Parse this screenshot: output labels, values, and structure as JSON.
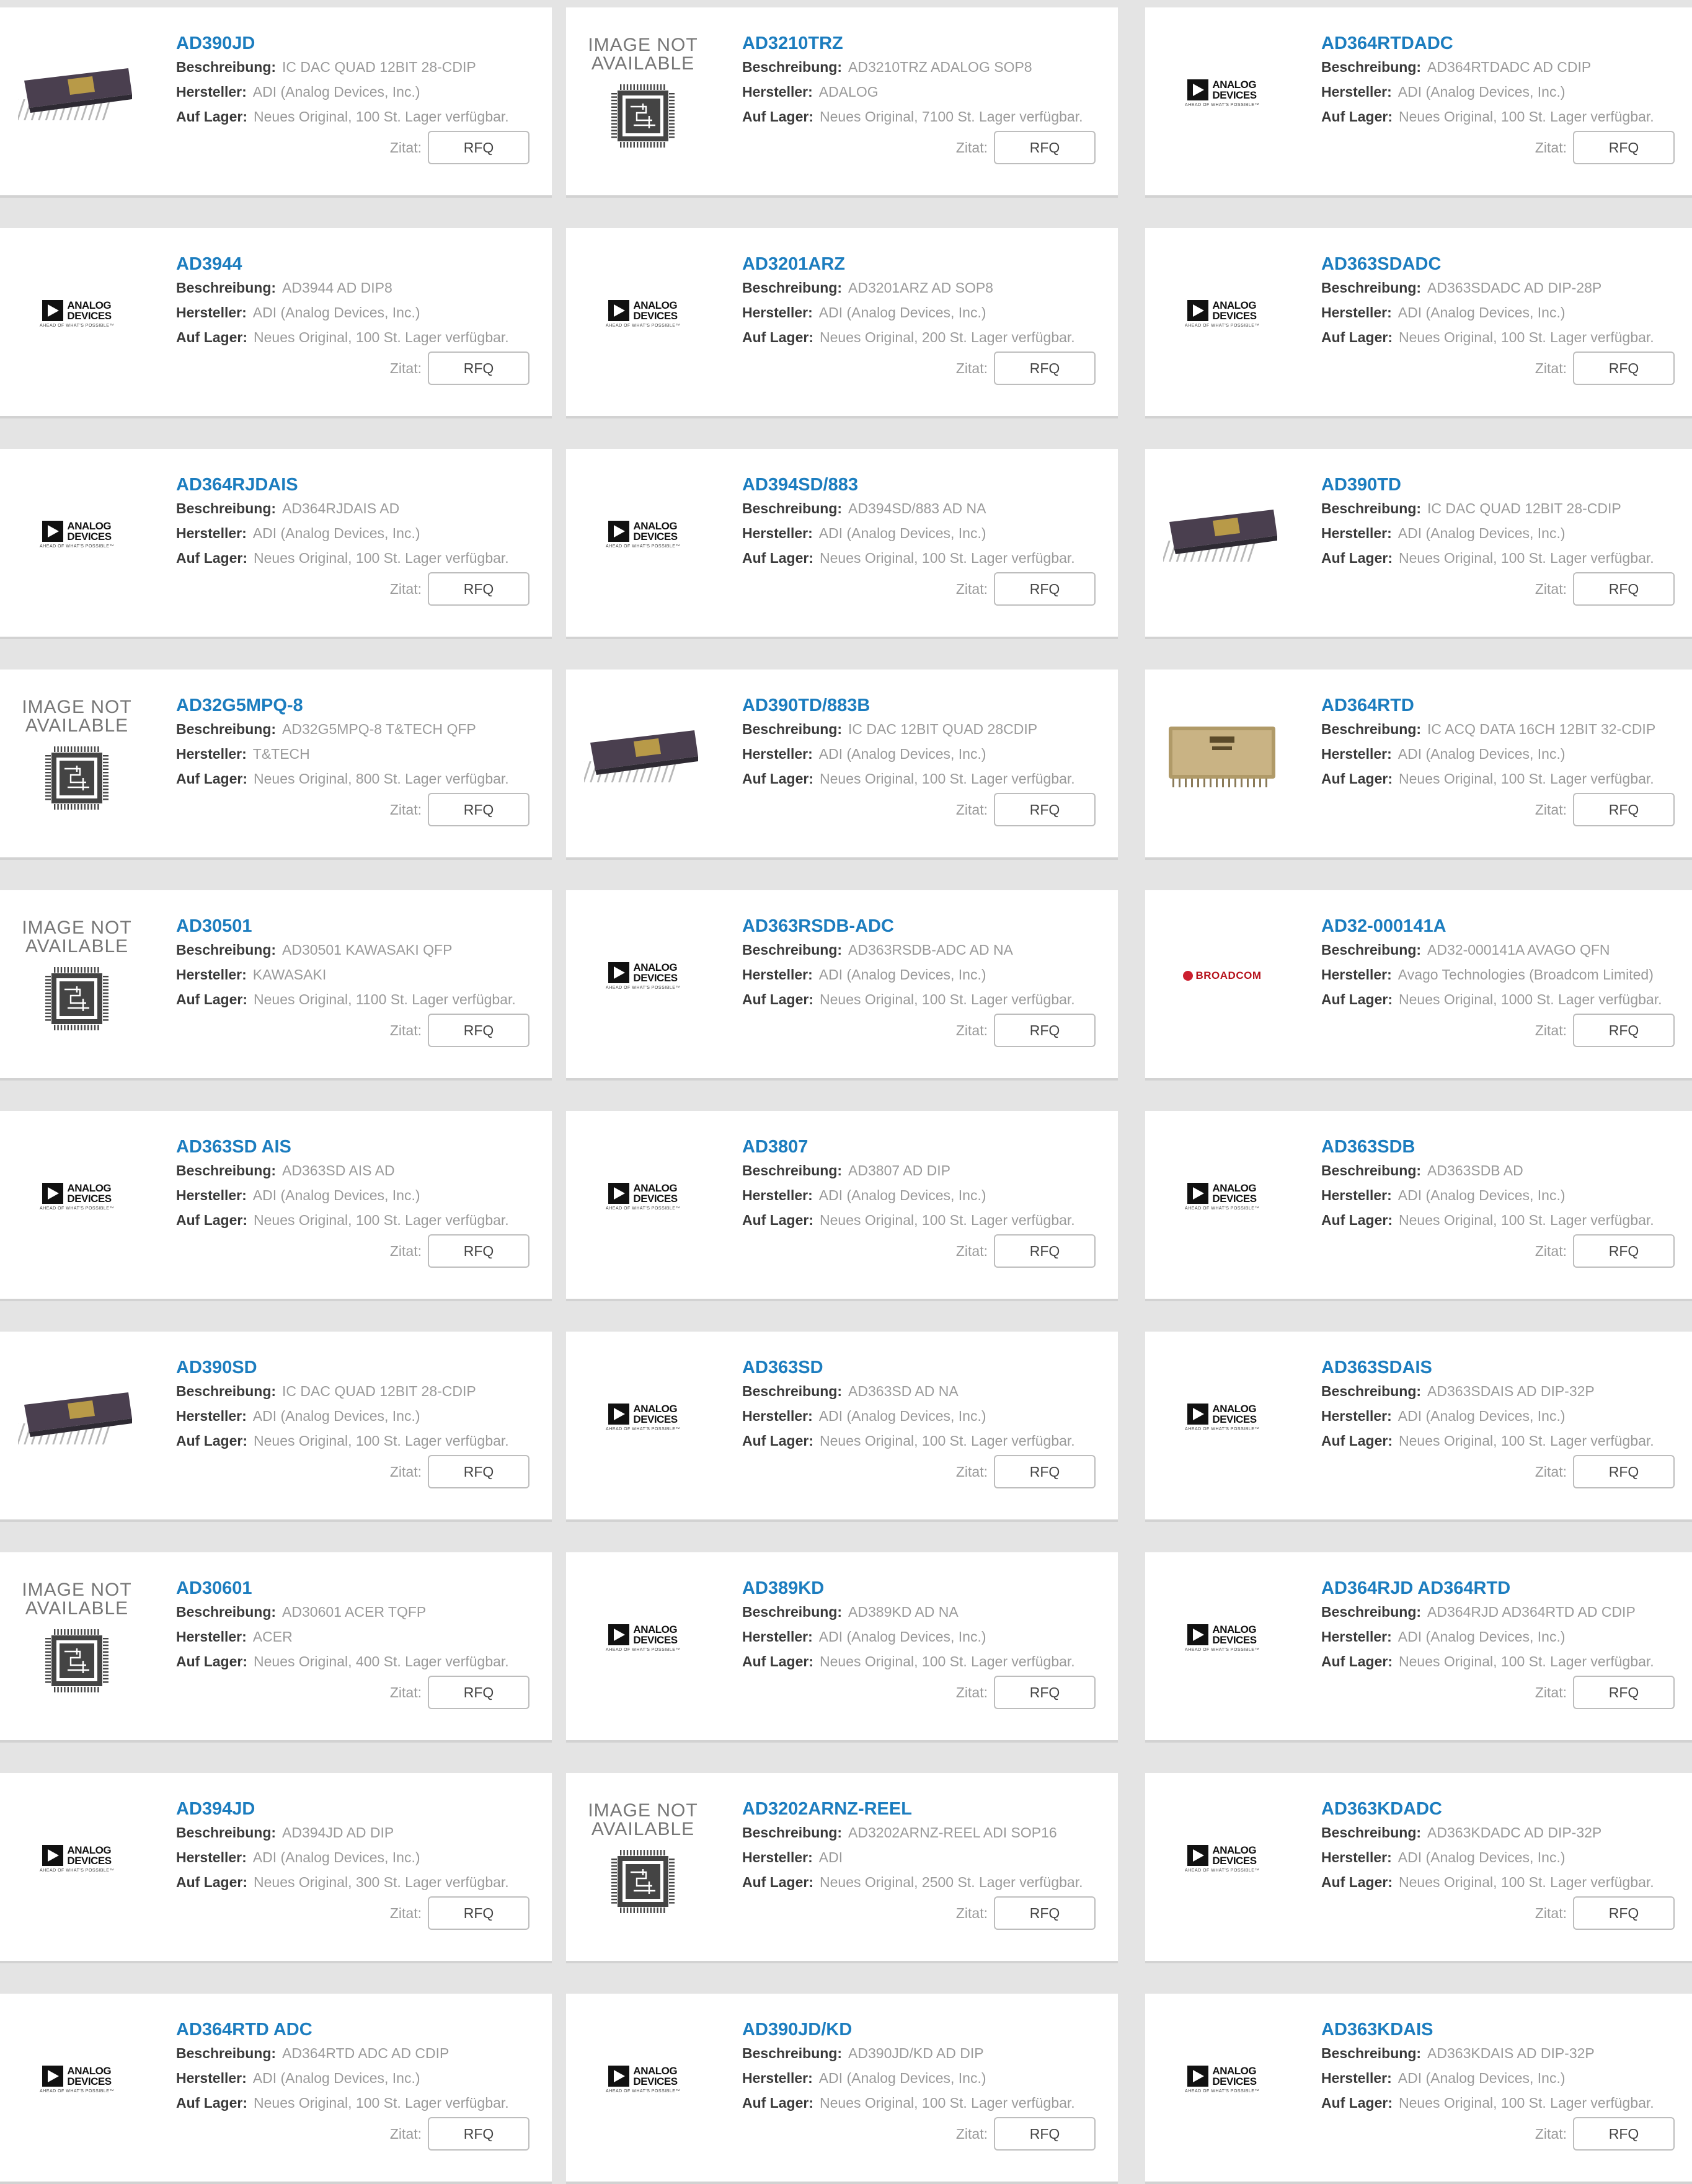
{
  "labels": {
    "description": "Beschreibung:",
    "manufacturer": "Hersteller:",
    "stock": "Auf Lager:",
    "quote": "Zitat:",
    "rfq": "RFQ"
  },
  "logo_text": {
    "adi_line1": "ANALOG",
    "adi_line2": "DEVICES",
    "adi_tagline": "AHEAD OF WHAT'S POSSIBLE™",
    "image_not_available_1": "IMAGE NOT",
    "image_not_available_2": "AVAILABLE",
    "broadcom": "BROADCOM"
  },
  "products": [
    {
      "pn": "AD390JD",
      "desc": "IC DAC QUAD 12BIT 28-CDIP",
      "mfr": "ADI (Analog Devices, Inc.)",
      "stock": "Neues Original, 100 St. Lager verfügbar.",
      "img": "dip-chip"
    },
    {
      "pn": "AD3210TRZ",
      "desc": "AD3210TRZ ADALOG SOP8",
      "mfr": "ADALOG",
      "stock": "Neues Original, 7100 St. Lager verfügbar.",
      "img": "image-not-available"
    },
    {
      "pn": "AD364RTDADC",
      "desc": "AD364RTDADC AD CDIP",
      "mfr": "ADI (Analog Devices, Inc.)",
      "stock": "Neues Original, 100 St. Lager verfügbar.",
      "img": "analog-devices-logo"
    },
    {
      "pn": "AD3944",
      "desc": "AD3944 AD DIP8",
      "mfr": "ADI (Analog Devices, Inc.)",
      "stock": "Neues Original, 100 St. Lager verfügbar.",
      "img": "analog-devices-logo"
    },
    {
      "pn": "AD3201ARZ",
      "desc": "AD3201ARZ AD SOP8",
      "mfr": "ADI (Analog Devices, Inc.)",
      "stock": "Neues Original, 200 St. Lager verfügbar.",
      "img": "analog-devices-logo"
    },
    {
      "pn": "AD363SDADC",
      "desc": "AD363SDADC AD DIP-28P",
      "mfr": "ADI (Analog Devices, Inc.)",
      "stock": "Neues Original, 100 St. Lager verfügbar.",
      "img": "analog-devices-logo"
    },
    {
      "pn": "AD364RJDAIS",
      "desc": "AD364RJDAIS AD",
      "mfr": "ADI (Analog Devices, Inc.)",
      "stock": "Neues Original, 100 St. Lager verfügbar.",
      "img": "analog-devices-logo"
    },
    {
      "pn": "AD394SD/883",
      "desc": "AD394SD/883 AD NA",
      "mfr": "ADI (Analog Devices, Inc.)",
      "stock": "Neues Original, 100 St. Lager verfügbar.",
      "img": "analog-devices-logo"
    },
    {
      "pn": "AD390TD",
      "desc": "IC DAC QUAD 12BIT 28-CDIP",
      "mfr": "ADI (Analog Devices, Inc.)",
      "stock": "Neues Original, 100 St. Lager verfügbar.",
      "img": "dip-chip"
    },
    {
      "pn": "AD32G5MPQ-8",
      "desc": "AD32G5MPQ-8 T&TECH QFP",
      "mfr": "T&TECH",
      "stock": "Neues Original, 800 St. Lager verfügbar.",
      "img": "image-not-available"
    },
    {
      "pn": "AD390TD/883B",
      "desc": "IC DAC 12BIT QUAD 28CDIP",
      "mfr": "ADI (Analog Devices, Inc.)",
      "stock": "Neues Original, 100 St. Lager verfügbar.",
      "img": "dip-chip"
    },
    {
      "pn": "AD364RTD",
      "desc": "IC ACQ DATA 16CH 12BIT 32-CDIP",
      "mfr": "ADI (Analog Devices, Inc.)",
      "stock": "Neues Original, 100 St. Lager verfügbar.",
      "img": "gold-module"
    },
    {
      "pn": "AD30501",
      "desc": "AD30501 KAWASAKI QFP",
      "mfr": "KAWASAKI",
      "stock": "Neues Original, 1100 St. Lager verfügbar.",
      "img": "image-not-available"
    },
    {
      "pn": "AD363RSDB-ADC",
      "desc": "AD363RSDB-ADC AD NA",
      "mfr": "ADI (Analog Devices, Inc.)",
      "stock": "Neues Original, 100 St. Lager verfügbar.",
      "img": "analog-devices-logo"
    },
    {
      "pn": "AD32-000141A",
      "desc": "AD32-000141A AVAGO QFN",
      "mfr": "Avago Technologies (Broadcom Limited)",
      "stock": "Neues Original, 1000 St. Lager verfügbar.",
      "img": "broadcom-logo"
    },
    {
      "pn": "AD363SD AIS",
      "desc": "AD363SD AIS AD",
      "mfr": "ADI (Analog Devices, Inc.)",
      "stock": "Neues Original, 100 St. Lager verfügbar.",
      "img": "analog-devices-logo"
    },
    {
      "pn": "AD3807",
      "desc": "AD3807 AD DIP",
      "mfr": "ADI (Analog Devices, Inc.)",
      "stock": "Neues Original, 100 St. Lager verfügbar.",
      "img": "analog-devices-logo"
    },
    {
      "pn": "AD363SDB",
      "desc": "AD363SDB AD",
      "mfr": "ADI (Analog Devices, Inc.)",
      "stock": "Neues Original, 100 St. Lager verfügbar.",
      "img": "analog-devices-logo"
    },
    {
      "pn": "AD390SD",
      "desc": "IC DAC QUAD 12BIT 28-CDIP",
      "mfr": "ADI (Analog Devices, Inc.)",
      "stock": "Neues Original, 100 St. Lager verfügbar.",
      "img": "dip-chip"
    },
    {
      "pn": "AD363SD",
      "desc": "AD363SD AD NA",
      "mfr": "ADI (Analog Devices, Inc.)",
      "stock": "Neues Original, 100 St. Lager verfügbar.",
      "img": "analog-devices-logo"
    },
    {
      "pn": "AD363SDAIS",
      "desc": "AD363SDAIS AD DIP-32P",
      "mfr": "ADI (Analog Devices, Inc.)",
      "stock": "Neues Original, 100 St. Lager verfügbar.",
      "img": "analog-devices-logo"
    },
    {
      "pn": "AD30601",
      "desc": "AD30601 ACER TQFP",
      "mfr": "ACER",
      "stock": "Neues Original, 400 St. Lager verfügbar.",
      "img": "image-not-available"
    },
    {
      "pn": "AD389KD",
      "desc": "AD389KD AD NA",
      "mfr": "ADI (Analog Devices, Inc.)",
      "stock": "Neues Original, 100 St. Lager verfügbar.",
      "img": "analog-devices-logo"
    },
    {
      "pn": "AD364RJD AD364RTD",
      "desc": "AD364RJD AD364RTD AD CDIP",
      "mfr": "ADI (Analog Devices, Inc.)",
      "stock": "Neues Original, 100 St. Lager verfügbar.",
      "img": "analog-devices-logo"
    },
    {
      "pn": "AD394JD",
      "desc": "AD394JD AD DIP",
      "mfr": "ADI (Analog Devices, Inc.)",
      "stock": "Neues Original, 300 St. Lager verfügbar.",
      "img": "analog-devices-logo"
    },
    {
      "pn": "AD3202ARNZ-REEL",
      "desc": "AD3202ARNZ-REEL ADI SOP16",
      "mfr": "ADI",
      "stock": "Neues Original, 2500 St. Lager verfügbar.",
      "img": "image-not-available"
    },
    {
      "pn": "AD363KDADC",
      "desc": "AD363KDADC AD DIP-32P",
      "mfr": "ADI (Analog Devices, Inc.)",
      "stock": "Neues Original, 100 St. Lager verfügbar.",
      "img": "analog-devices-logo"
    },
    {
      "pn": "AD364RTD ADC",
      "desc": "AD364RTD ADC AD CDIP",
      "mfr": "ADI (Analog Devices, Inc.)",
      "stock": "Neues Original, 100 St. Lager verfügbar.",
      "img": "analog-devices-logo"
    },
    {
      "pn": "AD390JD/KD",
      "desc": "AD390JD/KD AD DIP",
      "mfr": "ADI (Analog Devices, Inc.)",
      "stock": "Neues Original, 100 St. Lager verfügbar.",
      "img": "analog-devices-logo"
    },
    {
      "pn": "AD363KDAIS",
      "desc": "AD363KDAIS AD DIP-32P",
      "mfr": "ADI (Analog Devices, Inc.)",
      "stock": "Neues Original, 100 St. Lager verfügbar.",
      "img": "analog-devices-logo"
    }
  ]
}
